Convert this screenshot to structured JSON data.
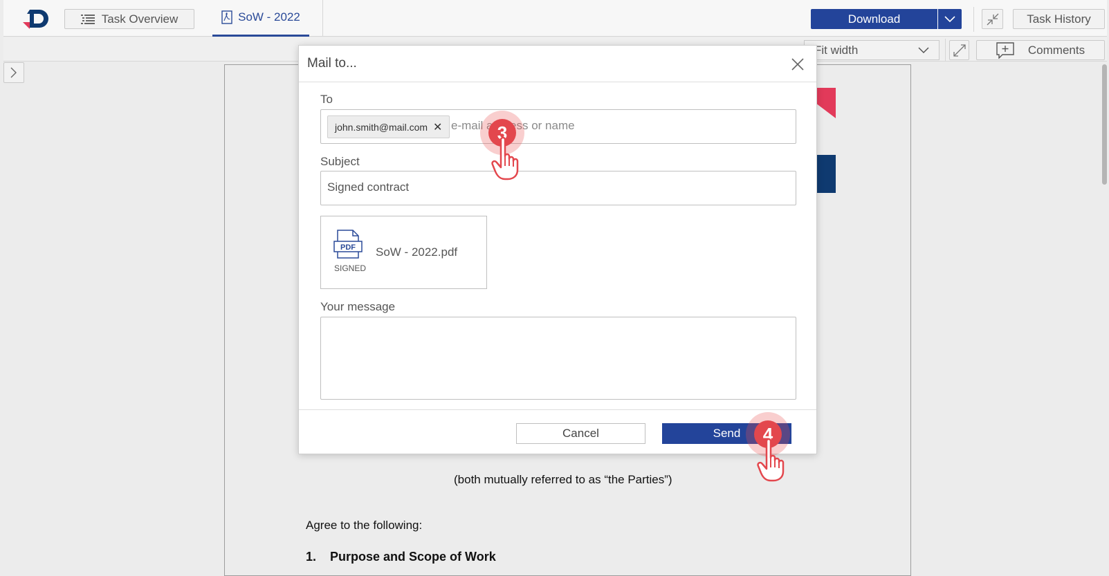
{
  "topbar": {
    "task_overview_label": "Task Overview",
    "active_tab_label": "SoW - 2022",
    "download_label": "Download",
    "task_history_label": "Task History"
  },
  "toolbar": {
    "zoom_selected": "Fit width",
    "comments_label": "Comments"
  },
  "document": {
    "parties_line": "(both mutually referred to as “the Parties”)",
    "agree_line": "Agree to the following:",
    "section_number": "1.",
    "section_title": "Purpose and Scope of Work"
  },
  "modal": {
    "title": "Mail to...",
    "to_label": "To",
    "recipient_chip": "john.smith@mail.com",
    "to_placeholder": "e-mail address or name",
    "subject_label": "Subject",
    "subject_value": "Signed contract",
    "attachment_icon_text": "PDF",
    "attachment_status": "SIGNED",
    "attachment_name": "SoW - 2022.pdf",
    "message_label": "Your message",
    "message_value": "",
    "cancel_label": "Cancel",
    "send_label": "Send"
  },
  "steps": {
    "step_a": "3",
    "step_b": "4"
  },
  "colors": {
    "brand_blue": "#23449a",
    "brand_red": "#e23a5a",
    "step_red": "#e3474d"
  }
}
